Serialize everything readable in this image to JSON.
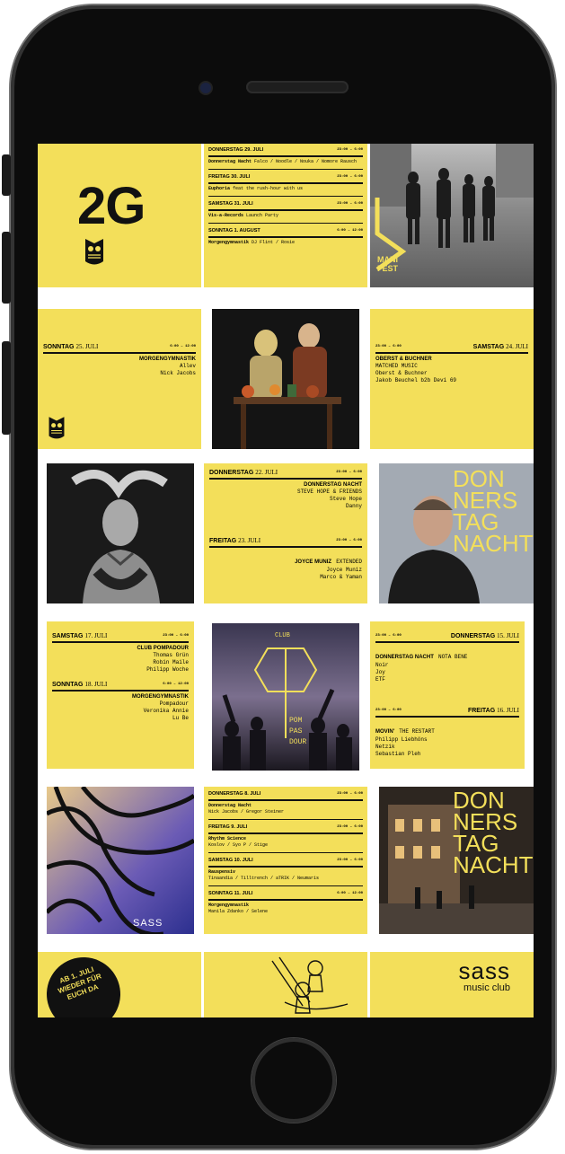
{
  "colors": {
    "yellow": "#f3df5a",
    "black": "#111111"
  },
  "row1": {
    "big_label": "2G",
    "schedule": [
      {
        "day": "DONNERSTAG 29. JULI",
        "time": "23:00 – 6:00",
        "event": "Donnerstag Nacht",
        "lineup": "Falco / Noodle / Nouka / Nomore Rausch"
      },
      {
        "day": "FREITAG 30. JULI",
        "time": "23:00 – 6:00",
        "event": "Euphoria",
        "lineup": "feat the rush-hour with us"
      },
      {
        "day": "SAMSTAG 31. JULI",
        "time": "23:00 – 6:00",
        "event": "Vis-a-Records",
        "lineup": "Launch Party"
      },
      {
        "day": "SONNTAG 1. AUGUST",
        "time": "6:00 – 12:00",
        "event": "Morgengymnastik",
        "lineup": "DJ Flint / Rosie"
      }
    ],
    "photo_caption": "MANI FEST"
  },
  "row2": {
    "left": {
      "day": "SONNTAG",
      "date": "25. JULI",
      "time": "6:00 – 12:00",
      "event": "MORGENGYMNASTIK",
      "lineup": [
        "Allev",
        "Nick Jacobs"
      ]
    },
    "right": {
      "day": "SAMSTAG",
      "date": "24. JULI",
      "time": "23:00 – 6:00",
      "event": "OBERST & BUCHNER",
      "lineup": [
        "MATCHED MUSIC",
        "Oberst & Buchner",
        "Jakob Beuchel b2b Devi 69"
      ]
    }
  },
  "row3": {
    "center": {
      "day1": "DONNERSTAG",
      "date1": "22. JULI",
      "time1": "23:00 – 6:00",
      "event1": "DONNERSTAG NACHT",
      "sub1": "STEVE HOPE & FRIENDS",
      "lineup1": [
        "Steve Hope",
        "Danny"
      ],
      "day2": "FREITAG",
      "date2": "23. JULI",
      "time2": "23:00 – 6:00",
      "event2": "JOYCE MUNIZ",
      "sub2": "EXTENDED",
      "lineup2": [
        "Joyce Muniz",
        "Marco & Yaman"
      ]
    },
    "right_text": [
      "DON",
      "NERS",
      "TAG",
      "NACHT"
    ]
  },
  "row4": {
    "left": {
      "day1": "SAMSTAG",
      "date1": "17. JULI",
      "time1": "23:00 – 6:00",
      "event1": "CLUB POMPADOUR",
      "lineup1": [
        "Thomas Grün",
        "Robin Maile",
        "Philipp Woche"
      ],
      "day2": "SONNTAG",
      "date2": "18. JULI",
      "time2": "6:00 – 12:00",
      "event2": "MORGENGYMNASTIK",
      "lineup2": [
        "Pompadour",
        "Veronika Annie",
        "Lu Be"
      ]
    },
    "center_text": [
      "CLUB",
      "POM",
      "PAS",
      "DOUR"
    ],
    "right": {
      "day1": "DONNERSTAG",
      "date1": "15. JULI",
      "time1": "23:00 – 6:00",
      "event1": "DONNERSTAG NACHT",
      "sub1": "NOTA BENE",
      "lineup1": [
        "Noir",
        "Joy",
        "ETF"
      ],
      "day2": "FREITAG",
      "date2": "16. JULI",
      "time2": "23:00 – 6:00",
      "event2": "MOVIN'",
      "sub2": "THE RESTART",
      "lineup2": [
        "Philipp Liebhöns",
        "Netzik",
        "Sebastian Pleh"
      ]
    }
  },
  "row5": {
    "left_logo": "SASS",
    "schedule": [
      {
        "day": "DONNERSTAG 8. JULI",
        "time": "23:00 – 6:00",
        "event": "Donnerstag Nacht",
        "lineup": "Nick Jacobs / Gregor Steiner"
      },
      {
        "day": "FREITAG 9. JULI",
        "time": "23:00 – 6:00",
        "event": "Rhythm Science",
        "lineup": "Koslov / Syo P / Stige"
      },
      {
        "day": "SAMSTAG 10. JULI",
        "time": "23:00 – 6:00",
        "event": "Rauspensiv",
        "lineup": "Tinaandia / Tilltrench / aTRIK / Neumaris"
      },
      {
        "day": "SONNTAG 11. JULI",
        "time": "6:00 – 12:00",
        "event": "Morgengymnastik",
        "lineup": "Manila Zdanko / Selene"
      }
    ],
    "right_text": [
      "DON",
      "NERS",
      "TAG",
      "NACHT"
    ]
  },
  "row6": {
    "badge": [
      "AB 1. JULI",
      "WIEDER FÜR",
      "EUCH DA"
    ],
    "brand": "sass",
    "brand_sub": "music club"
  }
}
